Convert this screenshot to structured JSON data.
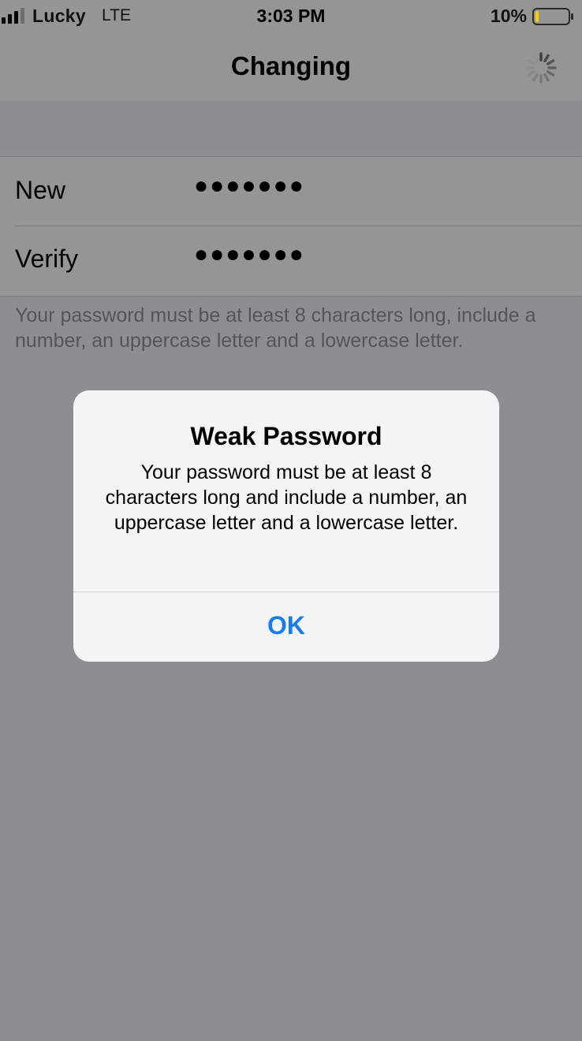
{
  "status_bar": {
    "carrier": "Lucky",
    "network": "LTE",
    "time": "3:03 PM",
    "battery_percent": "10%",
    "battery_level": 0.1,
    "battery_fill_color": "#ffcc00",
    "signal_icon": "cellular-signal-icon",
    "battery_icon": "battery-icon"
  },
  "nav": {
    "title": "Changing",
    "activity_icon": "loading-spinner-icon"
  },
  "form": {
    "new_label": "New",
    "new_value": "●●●●●●●",
    "verify_label": "Verify",
    "verify_value": "●●●●●●●",
    "footer_note": "Your password must be at least 8 characters long, include a number, an uppercase letter and a lowercase letter."
  },
  "alert": {
    "title": "Weak Password",
    "message": "Your password must be at least 8 characters long and include a number, an uppercase letter and a lowercase letter.",
    "ok_label": "OK",
    "button_color": "#1a7cf2"
  }
}
